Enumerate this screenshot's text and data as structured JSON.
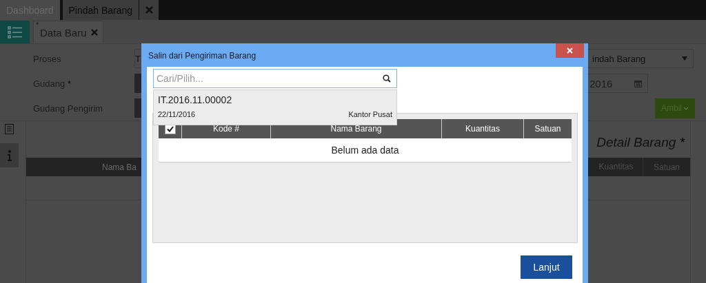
{
  "top_tabs": [
    {
      "label": "Dashboard",
      "selected": false
    },
    {
      "label": "Pindah Barang",
      "selected": true
    }
  ],
  "doc_tab": {
    "marker": "*",
    "label": "Data Baru"
  },
  "form": {
    "fields": [
      {
        "label": "Proses"
      },
      {
        "label": "Gudang",
        "required_mark": "*"
      },
      {
        "label": "Gudang Pengirim"
      }
    ],
    "proses_value": "T",
    "proses_select": "indah Barang",
    "date_value": "2016",
    "fetch_button": "Ambil"
  },
  "detail": {
    "title": "Detail Barang",
    "required_mark": "*",
    "columns": [
      "Nama Ba",
      "Kuantitas",
      "Satuan"
    ]
  },
  "modal": {
    "title": "Salin dari Pengiriman Barang",
    "search": {
      "placeholder": "Cari/Pilih..."
    },
    "suggestion": {
      "code": "IT.2016.11.00002",
      "date": "22/11/2016",
      "location": "Kantor Pusat"
    },
    "select_all": {
      "checked": true
    },
    "columns": [
      "Kode #",
      "Nama Barang",
      "Kuantitas",
      "Satuan"
    ],
    "empty_text": "Belum ada data",
    "button": "Lanjut"
  }
}
